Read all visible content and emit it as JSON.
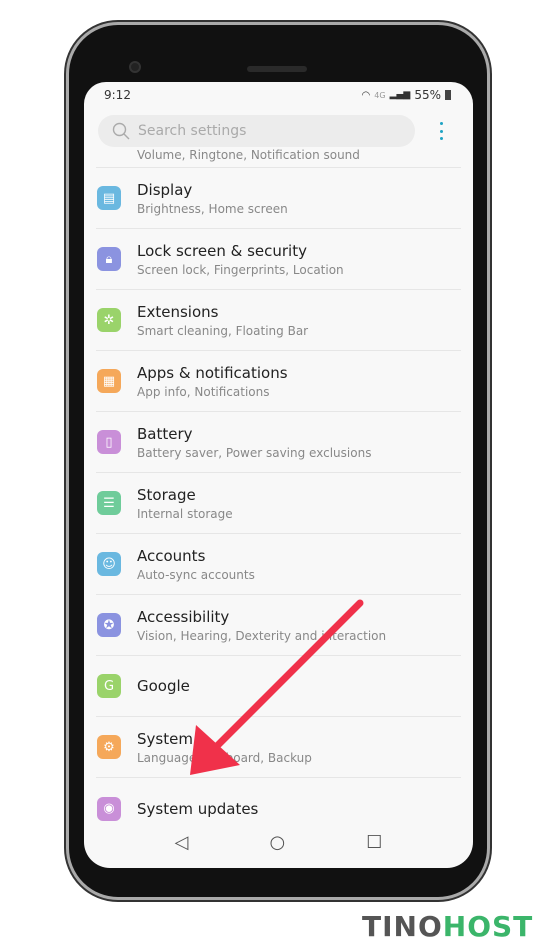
{
  "status": {
    "time": "9:12",
    "network": "4G",
    "battery": "55%"
  },
  "search": {
    "placeholder": "Search settings",
    "icon": "search-icon"
  },
  "partial_item": {
    "subtitle": "Volume, Ringtone, Notification sound"
  },
  "items": [
    {
      "title": "Display",
      "subtitle": "Brightness, Home screen",
      "color": "#6ab8e0",
      "icon": "display-icon"
    },
    {
      "title": "Lock screen & security",
      "subtitle": "Screen lock, Fingerprints, Location",
      "color": "#8b93e0",
      "icon": "lock-icon"
    },
    {
      "title": "Extensions",
      "subtitle": "Smart cleaning, Floating Bar",
      "color": "#9ad36a",
      "icon": "extensions-icon"
    },
    {
      "title": "Apps & notifications",
      "subtitle": "App info, Notifications",
      "color": "#f5a85a",
      "icon": "apps-icon"
    },
    {
      "title": "Battery",
      "subtitle": "Battery saver, Power saving exclusions",
      "color": "#c98fd8",
      "icon": "battery-icon"
    },
    {
      "title": "Storage",
      "subtitle": "Internal storage",
      "color": "#6fcc9a",
      "icon": "storage-icon"
    },
    {
      "title": "Accounts",
      "subtitle": "Auto-sync accounts",
      "color": "#6ab8e0",
      "icon": "accounts-icon"
    },
    {
      "title": "Accessibility",
      "subtitle": "Vision, Hearing, Dexterity and interaction",
      "color": "#8b93e0",
      "icon": "accessibility-icon"
    },
    {
      "title": "Google",
      "subtitle": "",
      "color": "#9ad36a",
      "icon": "google-icon"
    },
    {
      "title": "System",
      "subtitle": "Language, Keyboard, Backup",
      "color": "#f5a85a",
      "icon": "system-icon"
    },
    {
      "title": "System updates",
      "subtitle": "",
      "color": "#c98fd8",
      "icon": "system-updates-icon"
    }
  ],
  "annotation": {
    "arrow_color": "#f0314a"
  },
  "watermark": {
    "part1": "TINO",
    "part2": "HOST"
  }
}
